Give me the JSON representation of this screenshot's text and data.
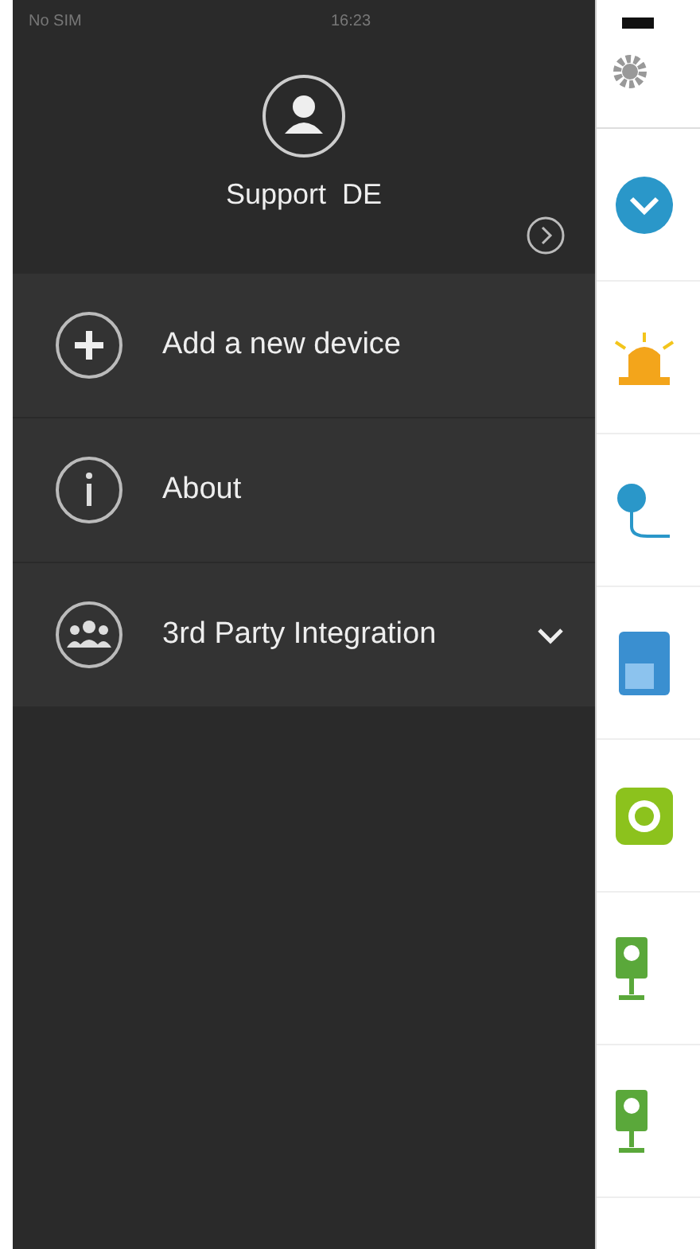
{
  "status_bar": {
    "carrier": "No SIM",
    "time": "16:23"
  },
  "profile": {
    "name": "Support  DE"
  },
  "menu": [
    {
      "kind": "add",
      "label": "Add a new device"
    },
    {
      "kind": "info",
      "label": "About"
    },
    {
      "kind": "group",
      "label": "3rd Party Integration",
      "expanded": false
    }
  ]
}
